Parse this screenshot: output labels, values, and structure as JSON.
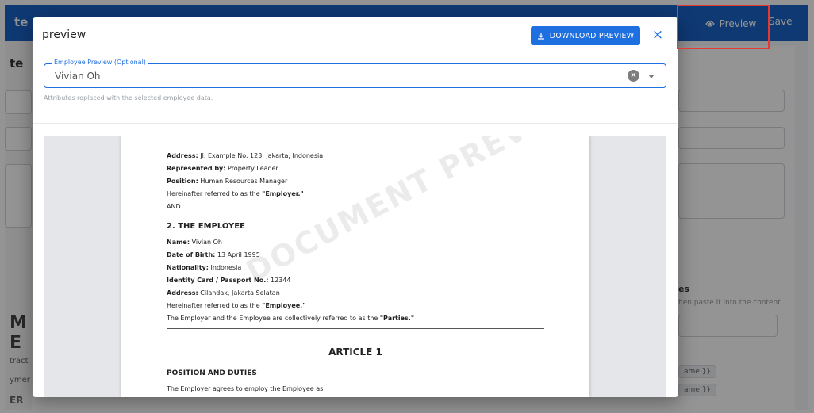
{
  "app": {
    "title": "te",
    "preview_label": "Preview",
    "save_label": "Save",
    "left_heading": "te",
    "left_big": "M E",
    "left_snippets": [
      "tract",
      "ymer",
      "ER"
    ],
    "right_heading": "es",
    "right_hint": "hen paste it into the content.",
    "right_chips": [
      "ame }}",
      "ame }}"
    ]
  },
  "modal": {
    "title": "preview",
    "download_label": "DOWNLOAD PREVIEW",
    "close_label": "×",
    "employee_field_label": "Employee Preview (Optional)",
    "employee_value": "Vivian Oh",
    "helper_text": "Attributes replaced with the selected employee data."
  },
  "document": {
    "watermark": "DOCUMENT PREVIEW",
    "employer": {
      "address_label": "Address:",
      "address": " Jl. Example No. 123, Jakarta, Indonesia",
      "represented_label": "Represented by:",
      "represented": " Property Leader",
      "position_label": "Position:",
      "position": " Human Resources Manager",
      "referred_prefix": "Hereinafter referred to as the ",
      "referred_term": "\"Employer.\"",
      "and": "AND"
    },
    "employee_heading": "2. THE EMPLOYEE",
    "employee": {
      "name_label": "Name:",
      "name": " Vivian Oh",
      "dob_label": "Date of Birth:",
      "dob": " 13 April 1995",
      "nationality_label": "Nationality:",
      "nationality": " Indonesia",
      "id_label": "Identity Card / Passport No.:",
      "id": " 12344",
      "address_label": "Address:",
      "address": " Cilandak, Jakarta Selatan",
      "referred_prefix": "Hereinafter referred to as the ",
      "referred_term": "\"Employee.\"",
      "parties_prefix": "The Employer and the Employee are collectively referred to as the ",
      "parties_term": "\"Parties.\""
    },
    "article_heading": "ARTICLE 1",
    "position_heading": "POSITION AND DUTIES",
    "position_text": "The Employer agrees to employ the Employee as:"
  }
}
